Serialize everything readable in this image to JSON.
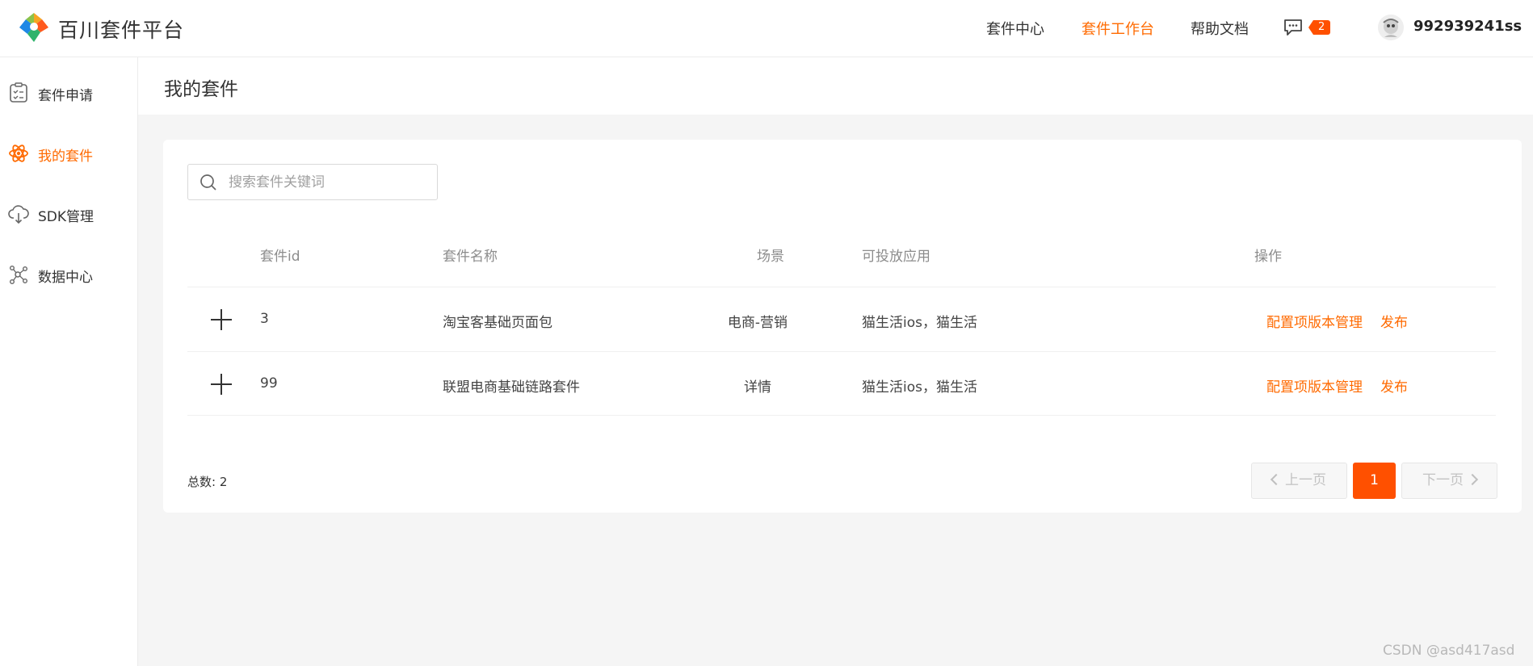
{
  "header": {
    "brand": "百川套件平台",
    "nav": [
      {
        "label": "套件中心",
        "active": false
      },
      {
        "label": "套件工作台",
        "active": true
      },
      {
        "label": "帮助文档",
        "active": false
      }
    ],
    "message_count": "2",
    "username": "992939241ss"
  },
  "sidebar": {
    "items": [
      {
        "label": "套件申请",
        "icon": "clipboard-icon",
        "active": false
      },
      {
        "label": "我的套件",
        "icon": "atom-icon",
        "active": true
      },
      {
        "label": "SDK管理",
        "icon": "cloud-download-icon",
        "active": false
      },
      {
        "label": "数据中心",
        "icon": "network-icon",
        "active": false
      }
    ]
  },
  "main": {
    "title": "我的套件",
    "search": {
      "placeholder": "搜索套件关键词",
      "value": ""
    },
    "table": {
      "columns": [
        "套件id",
        "套件名称",
        "场景",
        "可投放应用",
        "操作"
      ],
      "rows": [
        {
          "id": "3",
          "name": "淘宝客基础页面包",
          "scene": "电商-营销",
          "apps": "猫生活ios，猫生活",
          "actions": [
            "配置项版本管理",
            "发布"
          ]
        },
        {
          "id": "99",
          "name": "联盟电商基础链路套件",
          "scene": "详情",
          "apps": "猫生活ios，猫生活",
          "actions": [
            "配置项版本管理",
            "发布"
          ]
        }
      ]
    },
    "pagination": {
      "total_label": "总数: 2",
      "prev": "上一页",
      "current": "1",
      "next": "下一页"
    }
  },
  "watermark": "CSDN @asd417asd",
  "colors": {
    "accent": "#ff6a00",
    "badge": "#ff5000",
    "page_bg": "#f5f5f5"
  }
}
